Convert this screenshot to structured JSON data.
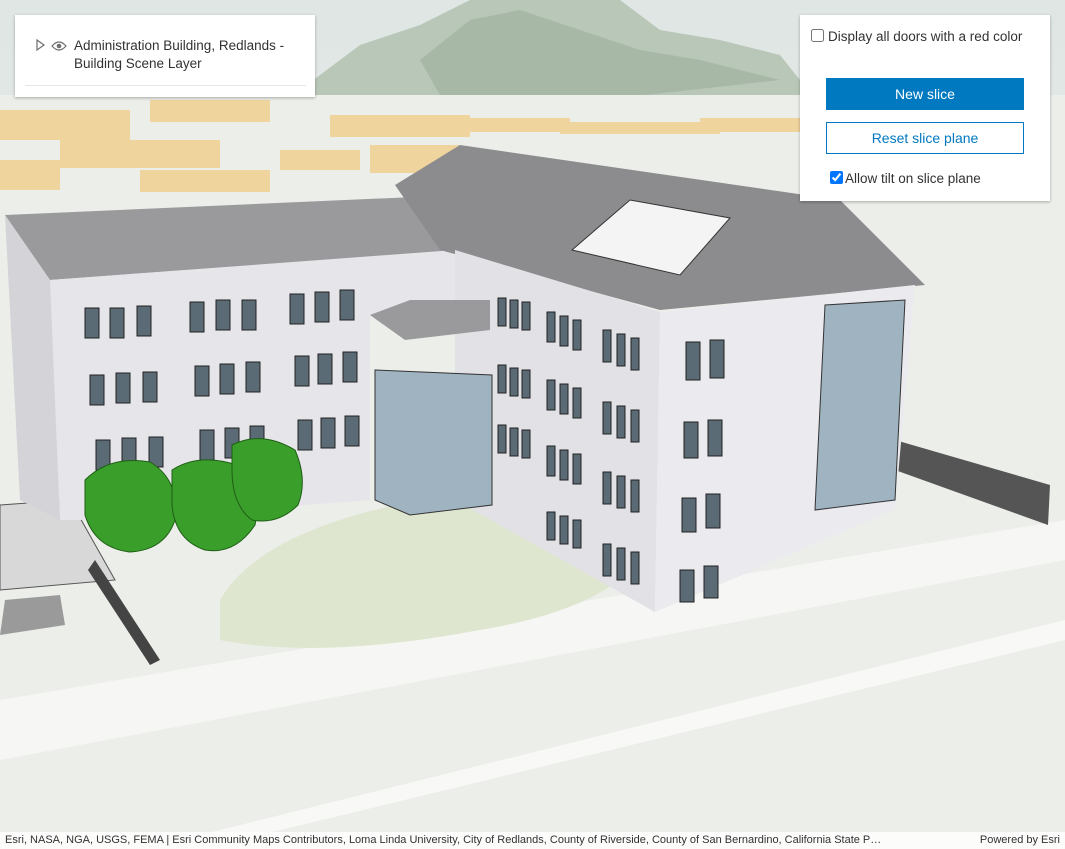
{
  "layer_list": {
    "layer_title": "Administration Building, Redlands - Building Scene Layer"
  },
  "slice_panel": {
    "doors_checkbox_label": "Display all doors with a red color",
    "doors_checked": false,
    "new_slice_label": "New slice",
    "reset_slice_label": "Reset slice plane",
    "tilt_checkbox_label": "Allow tilt on slice plane",
    "tilt_checked": true
  },
  "attribution": {
    "text": "Esri, NASA, NGA, USGS, FEMA | Esri Community Maps Contributors, Loma Linda University, City of Redlands, County of Riverside, County of San Bernardino, California State P…",
    "powered_by": "Powered by Esri"
  },
  "colors": {
    "accent": "#0079c1",
    "building_wall": "#e6e6ea",
    "roof": "#8c8c8e",
    "glass": "#9fb4c0",
    "tree": "#3a9e2a",
    "city_blocks": "#f1d6a4",
    "ground": "#eef0ec"
  },
  "icons": {
    "expand": "caret-right-icon",
    "visibility": "eye-icon"
  }
}
